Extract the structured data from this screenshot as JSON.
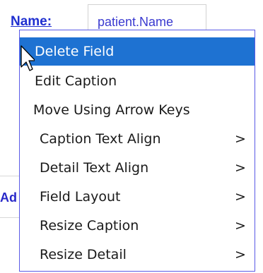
{
  "form": {
    "caption": "Name:",
    "detail": "patient.Name",
    "side_label": "Ad"
  },
  "context_menu": {
    "items": [
      {
        "label": "Delete Field",
        "arrow": ""
      },
      {
        "label": "Edit Caption",
        "arrow": ""
      },
      {
        "label": "Move Using Arrow Keys",
        "arrow": ""
      },
      {
        "label": "Caption Text Align",
        "arrow": ">"
      },
      {
        "label": "Detail Text Align",
        "arrow": ">"
      },
      {
        "label": "Field Layout",
        "arrow": ">"
      },
      {
        "label": "Resize Caption",
        "arrow": ">"
      },
      {
        "label": "Resize Detail",
        "arrow": ">"
      }
    ],
    "selected_index": 0
  },
  "colors": {
    "highlight": "#1e72d2",
    "caption_link": "#1f2fd0",
    "menu_border": "#5a5ae6"
  },
  "cursor_icon": "arrow-pointer-icon"
}
